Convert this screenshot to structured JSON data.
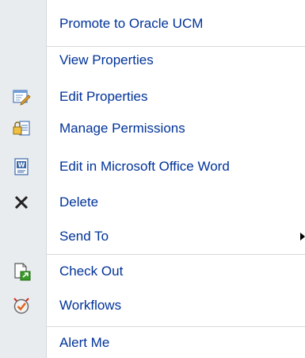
{
  "menu": {
    "items": [
      {
        "label": "Promote to Oracle UCM",
        "icon": "none"
      },
      {
        "label": "View Properties",
        "icon": "none"
      },
      {
        "label": "Edit Properties",
        "icon": "edit-properties-icon"
      },
      {
        "label": "Manage Permissions",
        "icon": "manage-permissions-icon"
      },
      {
        "label": "Edit in Microsoft Office Word",
        "icon": "word-document-icon"
      },
      {
        "label": "Delete",
        "icon": "delete-x-icon"
      },
      {
        "label": "Send To",
        "icon": "none",
        "submenu": true
      },
      {
        "label": "Check Out",
        "icon": "check-out-icon"
      },
      {
        "label": "Workflows",
        "icon": "workflows-icon"
      },
      {
        "label": "Alert Me",
        "icon": "none"
      }
    ]
  },
  "colors": {
    "label_text": "#003399",
    "gutter": "#e9ecef",
    "separator": "#d9d9d9"
  }
}
